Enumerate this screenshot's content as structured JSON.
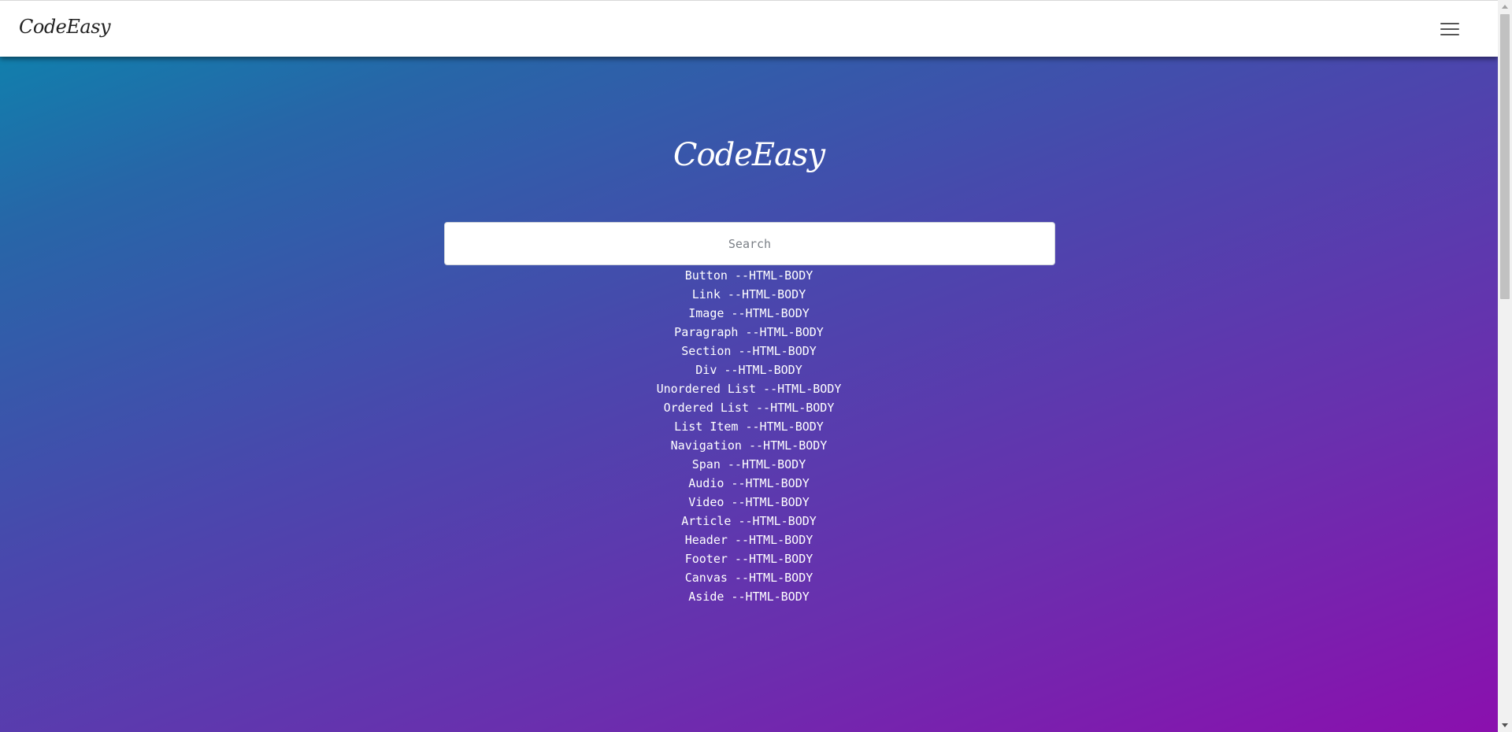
{
  "navbar": {
    "brand": "CodeEasy",
    "menu_icon": "hamburger-menu-icon"
  },
  "hero": {
    "title": "CodeEasy"
  },
  "search": {
    "placeholder": "Search",
    "value": ""
  },
  "results": [
    "Button --HTML-BODY",
    "Link --HTML-BODY",
    "Image --HTML-BODY",
    "Paragraph --HTML-BODY",
    "Section --HTML-BODY",
    "Div --HTML-BODY",
    "Unordered List --HTML-BODY",
    "Ordered List --HTML-BODY",
    "List Item --HTML-BODY",
    "Navigation --HTML-BODY",
    "Span --HTML-BODY",
    "Audio --HTML-BODY",
    "Video --HTML-BODY",
    "Article --HTML-BODY",
    "Header --HTML-BODY",
    "Footer --HTML-BODY",
    "Canvas --HTML-BODY",
    "Aside --HTML-BODY"
  ],
  "colors": {
    "gradient_start": "#0a87ae",
    "gradient_mid": "#4a47ad",
    "gradient_end": "#8b0fae",
    "text": "#ffffff"
  }
}
